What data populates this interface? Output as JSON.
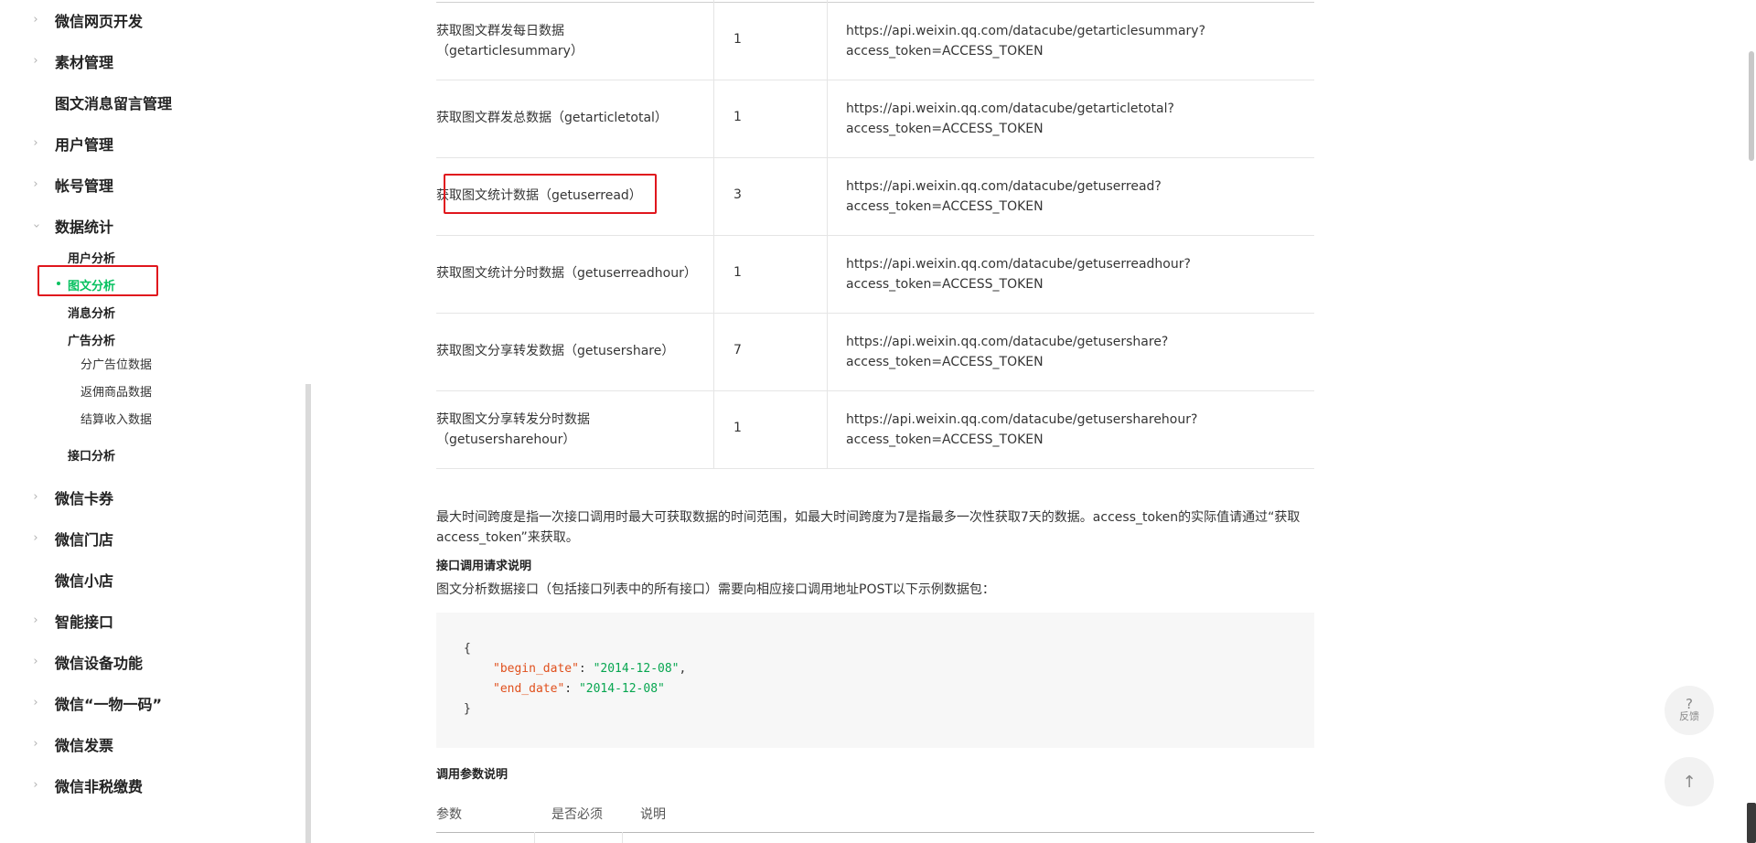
{
  "sidebar": {
    "items": [
      {
        "label": "微信网页开发",
        "chevron": "chevron-right"
      },
      {
        "label": "素材管理",
        "chevron": "chevron-right"
      },
      {
        "label": "图文消息留言管理",
        "chevron": ""
      },
      {
        "label": "用户管理",
        "chevron": "chevron-right"
      },
      {
        "label": "帐号管理",
        "chevron": "chevron-right"
      },
      {
        "label": "数据统计",
        "chevron": "chevron-down"
      },
      {
        "label": "微信卡券",
        "chevron": "chevron-right"
      },
      {
        "label": "微信门店",
        "chevron": "chevron-right"
      },
      {
        "label": "微信小店",
        "chevron": ""
      },
      {
        "label": "智能接口",
        "chevron": "chevron-right"
      },
      {
        "label": "微信设备功能",
        "chevron": "chevron-right"
      },
      {
        "label": "微信“一物一码”",
        "chevron": "chevron-right"
      },
      {
        "label": "微信发票",
        "chevron": "chevron-right"
      },
      {
        "label": "微信非税缴费",
        "chevron": "chevron-right"
      }
    ],
    "data_stats_children": {
      "user_analysis": "用户分析",
      "article_analysis": "图文分析",
      "message_analysis": "消息分析",
      "ad_analysis": "广告分析",
      "ad_sub": [
        "分广告位数据",
        "返佣商品数据",
        "结算收入数据"
      ],
      "api_analysis": "接口分析"
    },
    "accent_color": "#07c160"
  },
  "api_table": {
    "rows": [
      {
        "name": "获取图文群发每日数据（getarticlesummary）",
        "name_line1": "获取图文群发每日数据",
        "name_line2": "（getarticlesummary）",
        "count": "1",
        "url_line1": "https://api.weixin.qq.com/datacube/getarticlesummary?",
        "url_line2": "access_token=ACCESS_TOKEN"
      },
      {
        "name": "获取图文群发总数据（getarticletotal）",
        "name_line1": "获取图文群发总数据（getarticletotal）",
        "name_line2": "",
        "count": "1",
        "url_line1": "https://api.weixin.qq.com/datacube/getarticletotal?",
        "url_line2": "access_token=ACCESS_TOKEN"
      },
      {
        "name": "获取图文统计数据（getuserread）",
        "name_line1": "获取图文统计数据（getuserread）",
        "name_line2": "",
        "count": "3",
        "url_line1": "https://api.weixin.qq.com/datacube/getuserread?",
        "url_line2": "access_token=ACCESS_TOKEN"
      },
      {
        "name": "获取图文统计分时数据（getuserreadhour）",
        "name_line1": "获取图文统计分时数据（getuserreadhour）",
        "name_line2": "",
        "count": "1",
        "url_line1": "https://api.weixin.qq.com/datacube/getuserreadhour?",
        "url_line2": "access_token=ACCESS_TOKEN"
      },
      {
        "name": "获取图文分享转发数据（getusershare）",
        "name_line1": "获取图文分享转发数据（getusershare）",
        "name_line2": "",
        "count": "7",
        "url_line1": "https://api.weixin.qq.com/datacube/getusershare?",
        "url_line2": "access_token=ACCESS_TOKEN"
      },
      {
        "name": "获取图文分享转发分时数据（getusersharehour）",
        "name_line1": "获取图文分享转发分时数据",
        "name_line2": "（getusersharehour）",
        "count": "1",
        "url_line1": "https://api.weixin.qq.com/datacube/getusersharehour?",
        "url_line2": "access_token=ACCESS_TOKEN"
      }
    ]
  },
  "notes": {
    "max_span_line1": "最大时间跨度是指一次接口调用时最大可获取数据的时间范围，如最大时间跨度为7是指最多一次性获取7天的数据。access_token的实际值请通过“获取",
    "max_span_line2": "access_token”来获取。",
    "request_heading": "接口调用请求说明",
    "request_desc": "图文分析数据接口（包括接口列表中的所有接口）需要向相应接口调用地址POST以下示例数据包：",
    "code": {
      "open": "{",
      "begin_key": "\"begin_date\"",
      "begin_val": "\"2014-12-08\"",
      "end_key": "\"end_date\"",
      "end_val": "\"2014-12-08\"",
      "close": "}"
    },
    "params_heading": "调用参数说明",
    "params_columns": [
      "参数",
      "是否必须",
      "说明"
    ]
  },
  "floating": {
    "feedback_icon": "?",
    "feedback_label": "反馈",
    "top_icon": "↑"
  }
}
